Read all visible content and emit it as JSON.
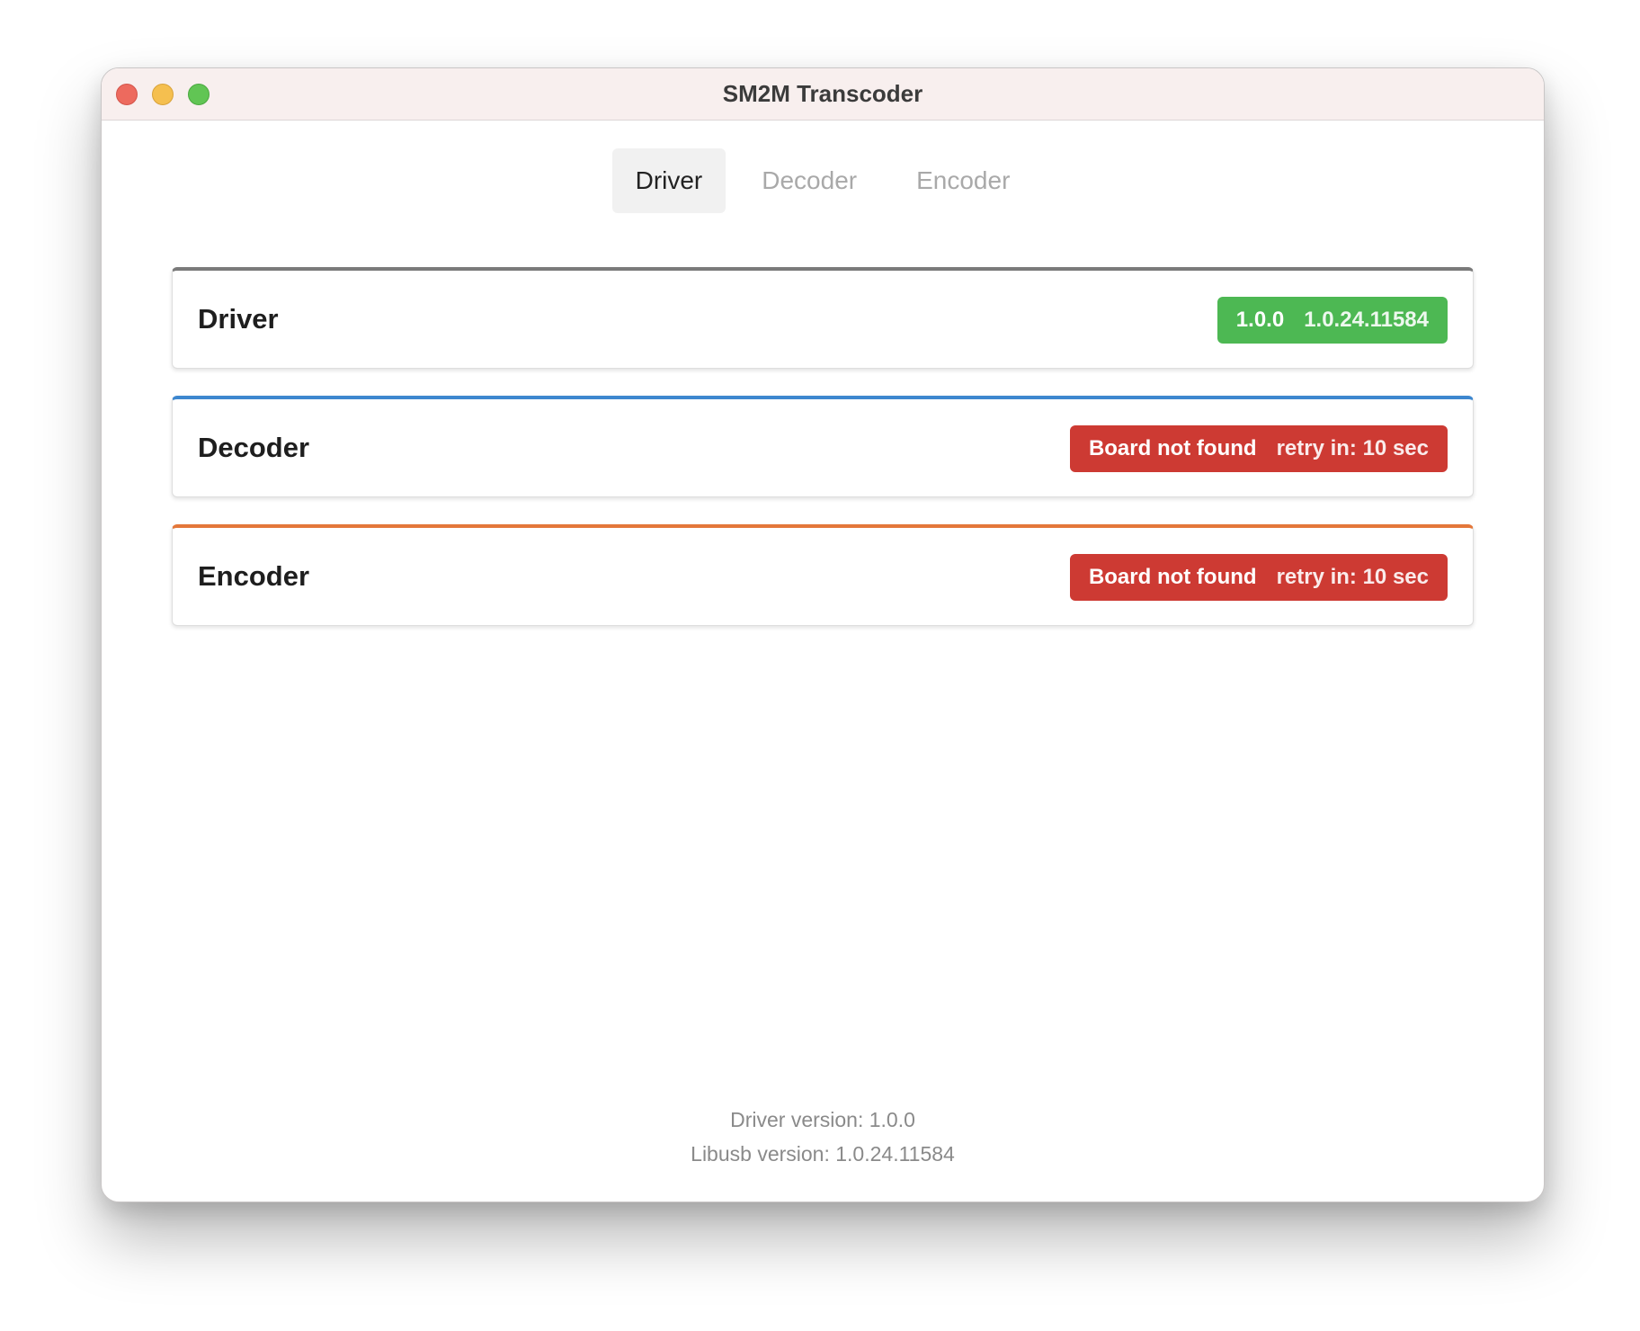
{
  "window": {
    "title": "SM2M Transcoder"
  },
  "tabs": [
    {
      "label": "Driver",
      "active": true
    },
    {
      "label": "Decoder",
      "active": false
    },
    {
      "label": "Encoder",
      "active": false
    }
  ],
  "cards": [
    {
      "label": "Driver",
      "accent_color": "#7a7a7a",
      "badge_color": "#4db853",
      "badge_primary": "1.0.0",
      "badge_secondary": "1.0.24.11584"
    },
    {
      "label": "Decoder",
      "accent_color": "#3d87cf",
      "badge_color": "#cd3a33",
      "badge_primary": "Board not found",
      "badge_secondary": "retry in: 10 sec"
    },
    {
      "label": "Encoder",
      "accent_color": "#e4773a",
      "badge_color": "#cd3a33",
      "badge_primary": "Board not found",
      "badge_secondary": "retry in: 10 sec"
    }
  ],
  "footer": {
    "driver_version": "Driver version: 1.0.0",
    "libusb_version": "Libusb version: 1.0.24.11584"
  }
}
